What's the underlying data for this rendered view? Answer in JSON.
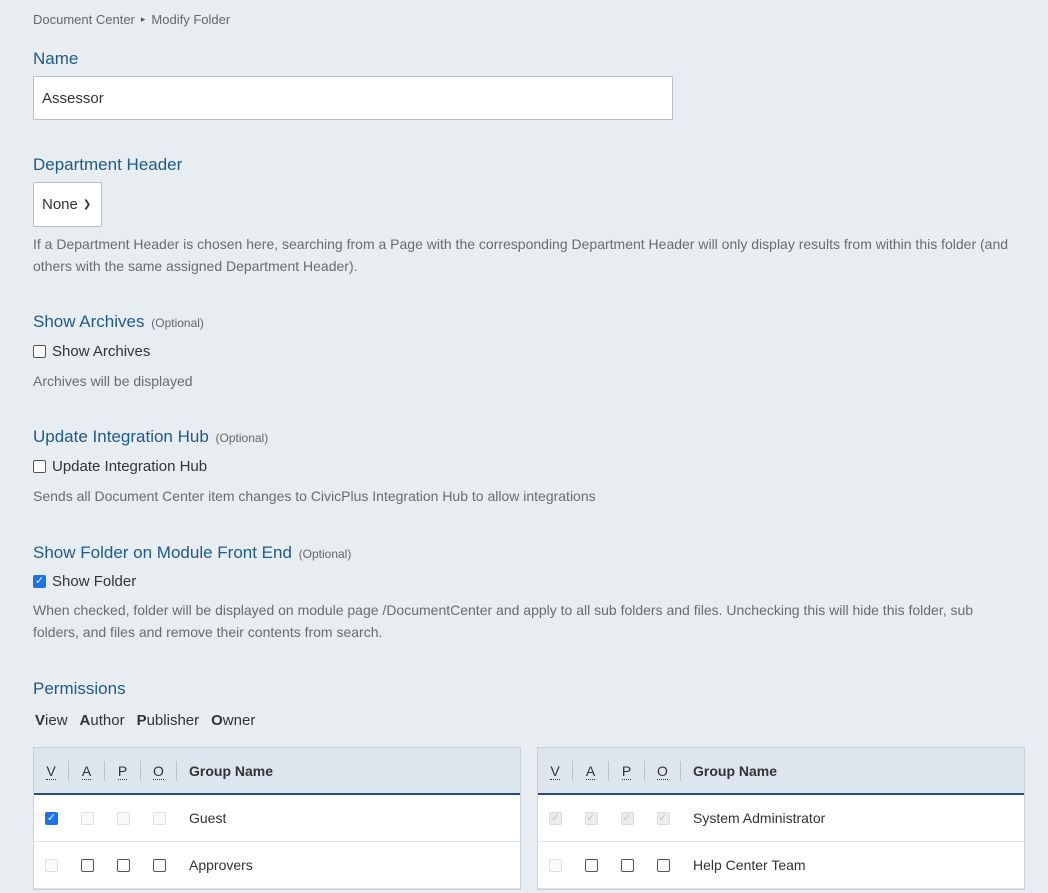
{
  "breadcrumb": {
    "root": "Document Center",
    "separator": "▸",
    "current": "Modify Folder"
  },
  "name": {
    "label": "Name",
    "value": "Assessor"
  },
  "department_header": {
    "label": "Department Header",
    "selected": "None",
    "help": "If a Department Header is chosen here, searching from a Page with the corresponding Department Header will only display results from within this folder (and others with the same assigned Department Header)."
  },
  "show_archives": {
    "label": "Show Archives",
    "optional": "(Optional)",
    "checkbox_label": "Show Archives",
    "checked": false,
    "help": "Archives will be displayed"
  },
  "update_hub": {
    "label": "Update Integration Hub",
    "optional": "(Optional)",
    "checkbox_label": "Update Integration Hub",
    "checked": false,
    "help": "Sends all Document Center item changes to CivicPlus Integration Hub to allow integrations"
  },
  "show_folder": {
    "label": "Show Folder on Module Front End",
    "optional": "(Optional)",
    "checkbox_label": "Show Folder",
    "checked": true,
    "help": "When checked, folder will be displayed on module page /DocumentCenter and apply to all sub folders and files. Unchecking this will hide this folder, sub folders, and files and remove their contents from search."
  },
  "permissions": {
    "label": "Permissions",
    "legend": [
      {
        "key": "V",
        "rest": "iew"
      },
      {
        "key": "A",
        "rest": "uthor"
      },
      {
        "key": "P",
        "rest": "ublisher"
      },
      {
        "key": "O",
        "rest": "wner"
      }
    ],
    "columns": [
      "V",
      "A",
      "P",
      "O"
    ],
    "group_header": "Group Name",
    "left_rows": [
      {
        "group": "Guest",
        "perms": [
          "checked",
          "disabled",
          "disabled",
          "disabled"
        ]
      },
      {
        "group": "Approvers",
        "perms": [
          "disabled",
          "unchecked",
          "unchecked",
          "unchecked"
        ]
      }
    ],
    "right_rows": [
      {
        "group": "System Administrator",
        "perms": [
          "disabled-checked",
          "disabled-checked",
          "disabled-checked",
          "disabled-checked"
        ]
      },
      {
        "group": "Help Center Team",
        "perms": [
          "disabled",
          "unchecked",
          "unchecked",
          "unchecked"
        ]
      }
    ]
  }
}
